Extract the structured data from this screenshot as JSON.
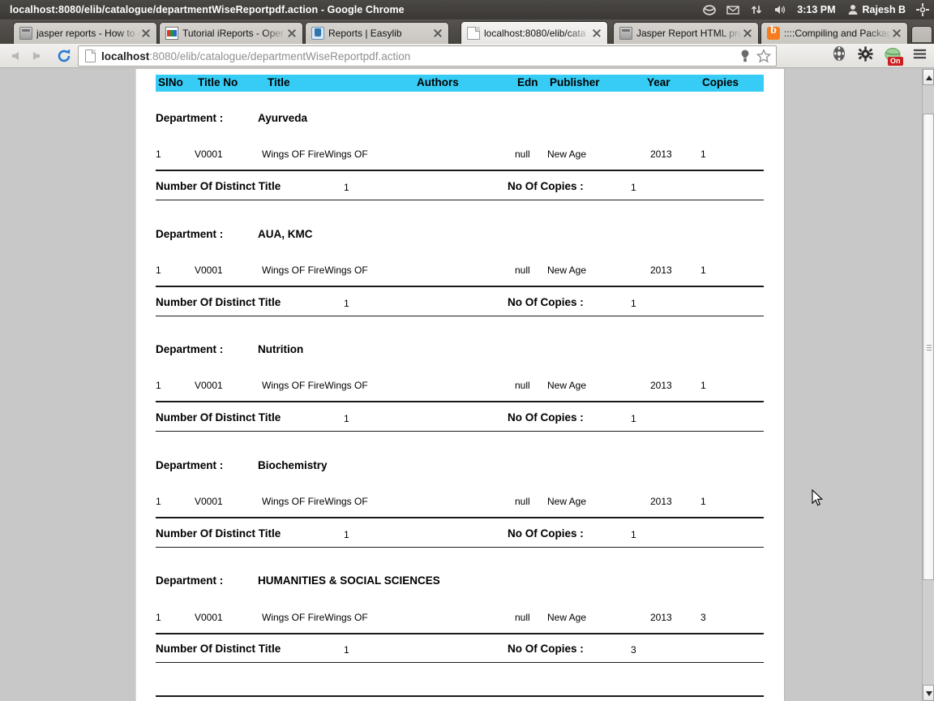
{
  "window": {
    "title": "localhost:8080/elib/catalogue/departmentWiseReportpdf.action - Google Chrome"
  },
  "tray": {
    "dropbox_icon": "dropbox-icon",
    "mail_icon": "mail-icon",
    "network_icon": "network-icon",
    "volume_icon": "volume-icon",
    "clock": "3:13 PM",
    "user_icon": "user-icon",
    "user": "Rajesh B",
    "settings_icon": "system-settings-icon"
  },
  "tabs": [
    {
      "label": "jasper reports - How to c",
      "icon": "jasper-favicon",
      "active": false
    },
    {
      "label": "Tutorial iReports - Oper",
      "icon": "ireport-favicon",
      "active": false
    },
    {
      "label": "Reports | Easylib",
      "icon": "easylib-favicon",
      "active": false
    },
    {
      "label": "localhost:8080/elib/cata",
      "icon": "document-favicon",
      "active": true
    },
    {
      "label": "Jasper Report HTML pre",
      "icon": "jasper-favicon",
      "active": false
    },
    {
      "label": "::::Compiling and Packag",
      "icon": "blogger-favicon",
      "active": false
    }
  ],
  "toolbar": {
    "back_icon": "back-arrow-icon",
    "forward_icon": "forward-arrow-icon",
    "reload_icon": "reload-icon",
    "page_icon": "page-icon",
    "url_host": "localhost",
    "url_rest": ":8080/elib/catalogue/departmentWiseReportpdf.action",
    "url_full": "localhost:8080/elib/catalogue/departmentWiseReportpdf.action",
    "lightbulb_icon": "lightbulb-icon",
    "bookmark_icon": "bookmark-star-icon",
    "film_icon": "film-reel-icon",
    "gear_icon": "gear-icon",
    "proxy_icon": "proxy-globe-icon",
    "proxy_badge": "On",
    "menu_icon": "hamburger-menu-icon"
  },
  "report": {
    "columns": [
      {
        "key": "slno",
        "label": "SlNo"
      },
      {
        "key": "title_no",
        "label": "Title No"
      },
      {
        "key": "title",
        "label": "Title"
      },
      {
        "key": "authors",
        "label": "Authors"
      },
      {
        "key": "edn",
        "label": "Edn"
      },
      {
        "key": "publisher",
        "label": "Publisher"
      },
      {
        "key": "year",
        "label": "Year"
      },
      {
        "key": "copies",
        "label": "Copies"
      }
    ],
    "dept_label": "Department :",
    "distinct_label": "Number Of Distinct Title",
    "copies_label": "No Of Copies :",
    "groups": [
      {
        "department": "Ayurveda",
        "rows": [
          {
            "slno": "1",
            "title_no": "V0001",
            "title": "Wings OF FireWings OF",
            "authors": "",
            "edn": "null",
            "publisher": "New Age",
            "year": "2013",
            "copies": "1"
          }
        ],
        "distinct_titles": "1",
        "total_copies": "1"
      },
      {
        "department": "AUA, KMC",
        "rows": [
          {
            "slno": "1",
            "title_no": "V0001",
            "title": "Wings OF FireWings OF",
            "authors": "",
            "edn": "null",
            "publisher": "New Age",
            "year": "2013",
            "copies": "1"
          }
        ],
        "distinct_titles": "1",
        "total_copies": "1"
      },
      {
        "department": "Nutrition",
        "rows": [
          {
            "slno": "1",
            "title_no": "V0001",
            "title": "Wings OF FireWings OF",
            "authors": "",
            "edn": "null",
            "publisher": "New Age",
            "year": "2013",
            "copies": "1"
          }
        ],
        "distinct_titles": "1",
        "total_copies": "1"
      },
      {
        "department": "Biochemistry",
        "rows": [
          {
            "slno": "1",
            "title_no": "V0001",
            "title": "Wings OF FireWings OF",
            "authors": "",
            "edn": "null",
            "publisher": "New Age",
            "year": "2013",
            "copies": "1"
          }
        ],
        "distinct_titles": "1",
        "total_copies": "1"
      },
      {
        "department": "HUMANITIES & SOCIAL SCIENCES",
        "rows": [
          {
            "slno": "1",
            "title_no": "V0001",
            "title": "Wings OF FireWings OF",
            "authors": "",
            "edn": "null",
            "publisher": "New Age",
            "year": "2013",
            "copies": "3"
          }
        ],
        "distinct_titles": "1",
        "total_copies": "3"
      }
    ]
  },
  "scrollbar": {
    "up_icon": "scroll-up-arrow-icon",
    "down_icon": "scroll-down-arrow-icon",
    "thumb_name": "vertical-scrollbar-thumb"
  },
  "colors": {
    "header_cyan": "#37ccf5",
    "page_bg": "#c8c8c8",
    "paper": "#ffffff",
    "titlebar": "#3b3835",
    "proxy_badge": "#cc1f1f"
  }
}
